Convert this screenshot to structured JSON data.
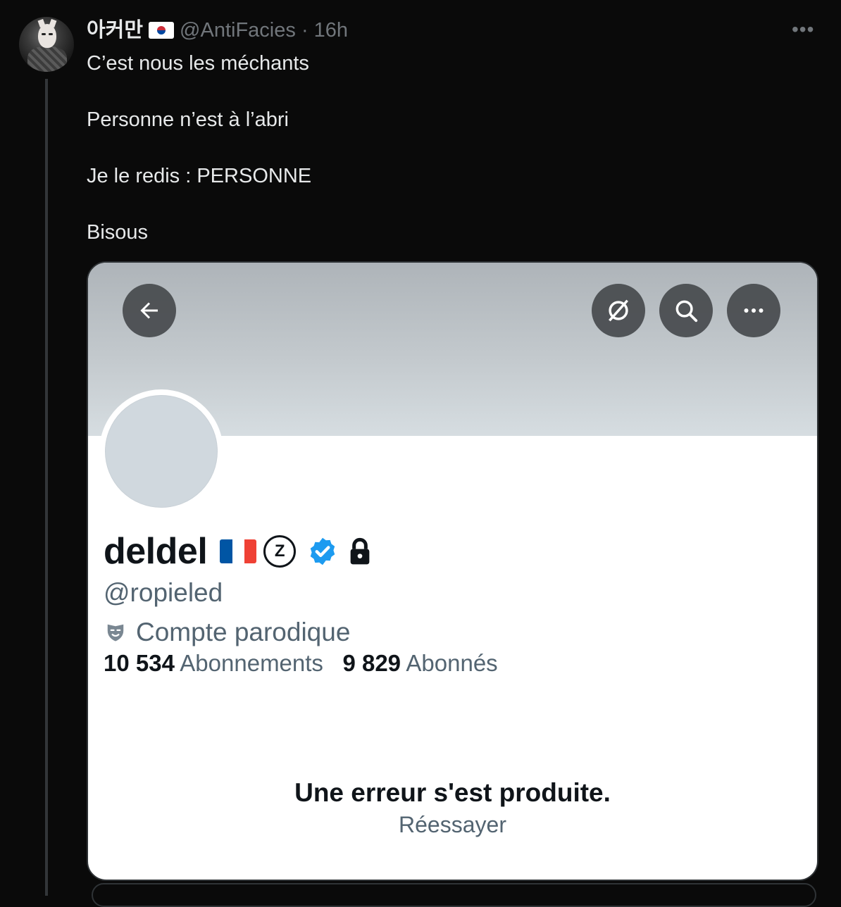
{
  "tweet": {
    "display_name": "아커만",
    "flag_emoji": "south-korea-flag",
    "handle": "@AntiFacies",
    "separator": "·",
    "time": "16h",
    "lines": [
      "C’est nous les méchants",
      "Personne n’est à l’abri",
      "Je le redis : PERSONNE",
      "Bisous"
    ]
  },
  "card": {
    "name": "deldel",
    "handle": "@ropieled",
    "parody_label": "Compte parodique",
    "following_count": "10 534",
    "following_label": "Abonnements",
    "followers_count": "9 829",
    "followers_label": "Abonnés",
    "error_title": "Une erreur s'est produite.",
    "retry_label": "Réessayer",
    "badge_letter": "Z"
  },
  "colors": {
    "background": "#0a0a0a",
    "verified_blue": "#1d9bf0",
    "muted_text": "#536471"
  }
}
